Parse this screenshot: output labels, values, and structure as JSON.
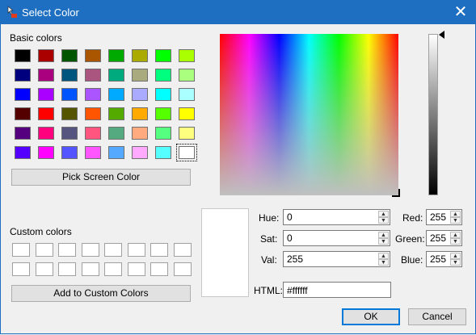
{
  "window": {
    "title": "Select Color",
    "close_glyph": "✕"
  },
  "basic": {
    "label": "Basic colors",
    "colors": [
      "#000000",
      "#aa0000",
      "#005500",
      "#aa5500",
      "#00aa00",
      "#aaaa00",
      "#00ff00",
      "#aaff00",
      "#00007f",
      "#aa007f",
      "#00557f",
      "#aa557f",
      "#00aa7f",
      "#aaaa7f",
      "#00ff7f",
      "#aaff7f",
      "#0000ff",
      "#aa00ff",
      "#0055ff",
      "#aa55ff",
      "#00aaff",
      "#aaaaff",
      "#00ffff",
      "#aaffff",
      "#550000",
      "#ff0000",
      "#555500",
      "#ff5500",
      "#55aa00",
      "#ffaa00",
      "#55ff00",
      "#ffff00",
      "#55007f",
      "#ff007f",
      "#55557f",
      "#ff557f",
      "#55aa7f",
      "#ffaa7f",
      "#55ff7f",
      "#ffff7f",
      "#5500ff",
      "#ff00ff",
      "#5555ff",
      "#ff55ff",
      "#55aaff",
      "#ffaaff",
      "#55ffff",
      "#ffffff"
    ],
    "selected_index": 47
  },
  "pick_screen_label": "Pick Screen Color",
  "custom": {
    "label": "Custom colors",
    "count": 16,
    "color": "#ffffff"
  },
  "add_custom_label": "Add to Custom Colors",
  "preview_color": "#ffffff",
  "hsv": {
    "hue_label": "Hue:",
    "hue": "0",
    "sat_label": "Sat:",
    "sat": "0",
    "val_label": "Val:",
    "val": "255"
  },
  "rgb": {
    "red_label": "Red:",
    "red": "255",
    "green_label": "Green:",
    "green": "255",
    "blue_label": "Blue:",
    "blue": "255"
  },
  "html": {
    "label": "HTML:",
    "value": "#ffffff"
  },
  "ok_label": "OK",
  "cancel_label": "Cancel",
  "icons": {
    "spin_up": "▲",
    "spin_down": "▼",
    "app": "color-dialog-icon"
  }
}
